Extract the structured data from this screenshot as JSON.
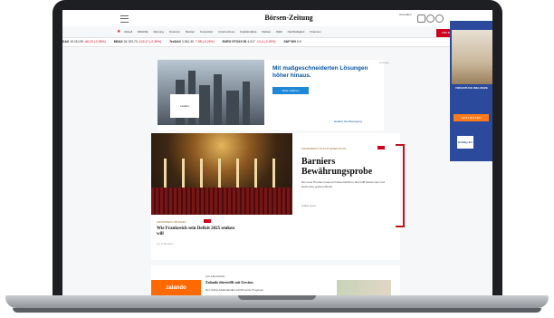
{
  "header": {
    "masthead": "Börsen-Zeitung",
    "login_label": "Anmelden",
    "abo_button": "ABO BUTTON",
    "nav_items": [
      "Aktuell",
      "ENGINE",
      "Meinung",
      "Finanzen",
      "Banken",
      "Konjunktur",
      "Unternehmen",
      "Kapitalmärkte",
      "Medien",
      "Wahl",
      "Nachhaltigkeit",
      "Finanzen"
    ]
  },
  "ticker": [
    {
      "name": "DAX",
      "value": "19.210,90",
      "change": "-66,23 (-0,35%)"
    },
    {
      "name": "MDAX",
      "value": "26.783,70",
      "change": "-102,47 (-0,38%)"
    },
    {
      "name": "TecDAX",
      "value": "3.381,30",
      "change": "-7,98 (-0,24%)"
    },
    {
      "name": "EURO STOXX 50",
      "value": "4.917",
      "change": "-14,4 (-0,29%)"
    },
    {
      "name": "S&P 500",
      "value": "5.9",
      "change": ""
    }
  ],
  "ad": {
    "headline": "Mit maßgeschneiderten Lösungen höher hinaus.",
    "button": "Mehr erfahren",
    "logo": "Helaba",
    "footer": "Helaba. Die Bewegung.",
    "tag": "Anzeige"
  },
  "hero": {
    "kicker": "FRANKREICH SUCHT EINEN PLAN",
    "title": "Barniers Bewährungsprobe",
    "text": "Der neue Premier muss ein hohes Defizit in den Griff bekommen und steht unter großem Druck.",
    "more": "Artikel lesen"
  },
  "subarticle": {
    "kicker": "FRANKREICH BUDGET",
    "title": "Wie Frankreich sein Defizit 2025 senken will",
    "meta": "vor 2 Stunden"
  },
  "skyscraper": {
    "text": "FRÜHSTÜCK INKLUSIVE",
    "button": "JETZT BUCHEN",
    "logo": "Holiday Inn"
  },
  "bottom": {
    "kicker": "ONLINEHANDEL",
    "title": "Zalando übertrifft mit Gewinn",
    "text": "Der Online-Modehändler erhöht seine Prognose.",
    "brand": "zalando"
  }
}
